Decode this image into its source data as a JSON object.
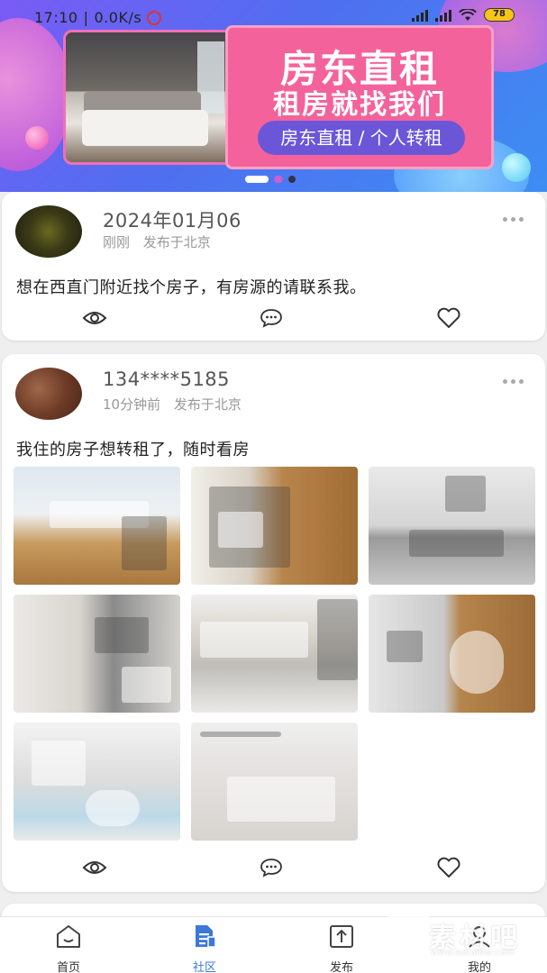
{
  "status_bar": {
    "time": "17:10",
    "speed": "0.0K/s",
    "battery": "78"
  },
  "banner": {
    "title": "房东直租",
    "subtitle": "租房就找我们",
    "pill": "房东直租 / 个人转租",
    "page_indicator": {
      "count": 3,
      "active": 1
    }
  },
  "posts": [
    {
      "user": "2024年01月06",
      "time": "刚刚",
      "location": "发布于北京",
      "text": "想在西直门附近找个房子，有房源的请联系我。"
    },
    {
      "user": "134****5185",
      "time": "10分钟前",
      "location": "发布于北京",
      "text": "我住的房子想转租了，随时看房",
      "photo_count": 8
    }
  ],
  "actions": {
    "view_icon": "eye-icon",
    "comment_icon": "comment-icon",
    "like_icon": "heart-icon"
  },
  "nav": {
    "home": "首页",
    "community": "社区",
    "publish": "发布",
    "mine": "我的",
    "active": "community"
  },
  "watermark": {
    "text": "素材吧",
    "url": "www.sucaibar.com"
  },
  "colors": {
    "accent": "#3b78d8",
    "promo_pink": "#f4629b",
    "pill_purple": "#6b56d8"
  }
}
